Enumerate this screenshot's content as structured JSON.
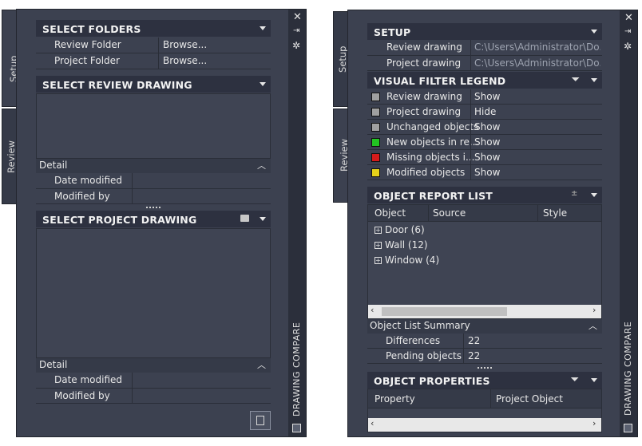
{
  "left": {
    "tabs": [
      "Setup",
      "Review"
    ],
    "title": "DRAWING COMPARE",
    "select_folders": {
      "title": "SELECT FOLDERS",
      "rows": [
        {
          "label": "Review Folder",
          "value": "Browse..."
        },
        {
          "label": "Project Folder",
          "value": "Browse..."
        }
      ]
    },
    "select_review": {
      "title": "SELECT REVIEW DRAWING",
      "detail": "Detail",
      "rows": [
        "Date modified",
        "Modified by"
      ]
    },
    "select_project": {
      "title": "SELECT PROJECT DRAWING",
      "detail": "Detail",
      "rows": [
        "Date modified",
        "Modified by"
      ]
    }
  },
  "right": {
    "tabs": [
      "Setup",
      "Review"
    ],
    "title": "DRAWING COMPARE",
    "setup": {
      "title": "SETUP",
      "rows": [
        {
          "label": "Review drawing",
          "value": "C:\\Users\\Administrator\\Do..."
        },
        {
          "label": "Project drawing",
          "value": "C:\\Users\\Administrator\\Do..."
        }
      ]
    },
    "legend": {
      "title": "VISUAL FILTER LEGEND",
      "rows": [
        {
          "label": "Review drawing",
          "value": "Show",
          "color": "#a0a0a0"
        },
        {
          "label": "Project drawing",
          "value": "Hide",
          "color": "#a0a0a0"
        },
        {
          "label": "Unchanged objects",
          "value": "Show",
          "color": "#a0a0a0"
        },
        {
          "label": "New objects in re...",
          "value": "Show",
          "color": "#22c422"
        },
        {
          "label": "Missing objects i...",
          "value": "Show",
          "color": "#d41b1b"
        },
        {
          "label": "Modified objects",
          "value": "Show",
          "color": "#e6d21a"
        }
      ]
    },
    "report": {
      "title": "OBJECT REPORT LIST",
      "columns": [
        "Object",
        "Source",
        "Style"
      ],
      "items": [
        "Door (6)",
        "Wall (12)",
        "Window (4)"
      ],
      "summary_title": "Object List Summary",
      "summary": [
        {
          "label": "Differences",
          "value": "22"
        },
        {
          "label": "Pending objects",
          "value": "22"
        }
      ]
    },
    "props": {
      "title": "OBJECT PROPERTIES",
      "columns": [
        "Property",
        "Project Object"
      ]
    }
  }
}
